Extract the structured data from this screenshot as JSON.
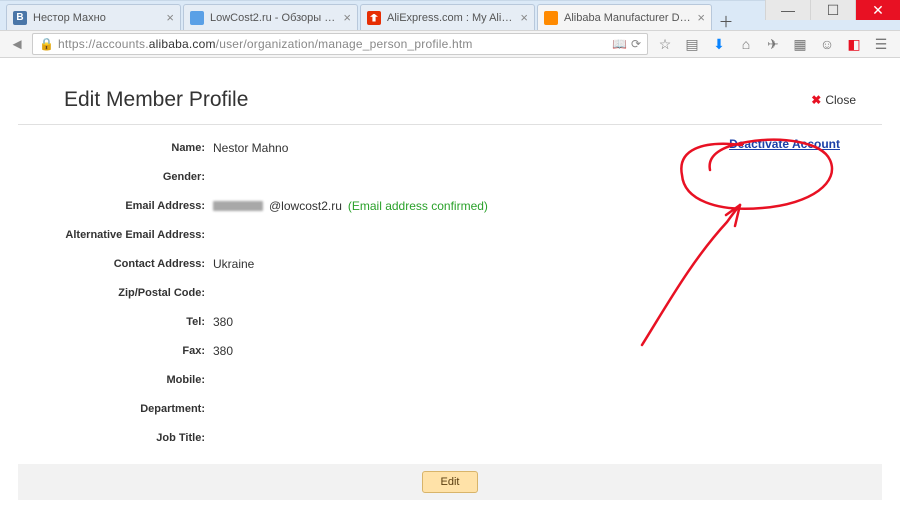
{
  "window": {
    "tabs": [
      {
        "label": "Нестор Махно",
        "icon": "vk"
      },
      {
        "label": "LowCost2.ru - Обзоры тов…",
        "icon": "lc"
      },
      {
        "label": "AliExpress.com : My AliExp…",
        "icon": "ae"
      },
      {
        "label": "Alibaba Manufacturer Dire…",
        "icon": "ali",
        "active": true
      }
    ]
  },
  "addressbar": {
    "scheme": "https://",
    "host_pre": "accounts.",
    "host": "alibaba.com",
    "path": "/user/organization/manage_person_profile.htm"
  },
  "page": {
    "title": "Edit Member Profile",
    "close_label": "Close",
    "deactivate_label": "Deactivate Account",
    "edit_label": "Edit",
    "fields": {
      "name_label": "Name:",
      "name_value": "Nestor Mahno",
      "gender_label": "Gender:",
      "gender_value": "",
      "email_label": "Email Address:",
      "email_domain": "@lowcost2.ru",
      "email_confirmed": "(Email address confirmed)",
      "alt_email_label": "Alternative Email Address:",
      "alt_email_value": "",
      "contact_label": "Contact Address:",
      "contact_value": "Ukraine",
      "zip_label": "Zip/Postal Code:",
      "zip_value": "",
      "tel_label": "Tel:",
      "tel_value": "380",
      "fax_label": "Fax:",
      "fax_value": "380",
      "mobile_label": "Mobile:",
      "mobile_value": "",
      "department_label": "Department:",
      "department_value": "",
      "job_label": "Job Title:",
      "job_value": ""
    }
  }
}
